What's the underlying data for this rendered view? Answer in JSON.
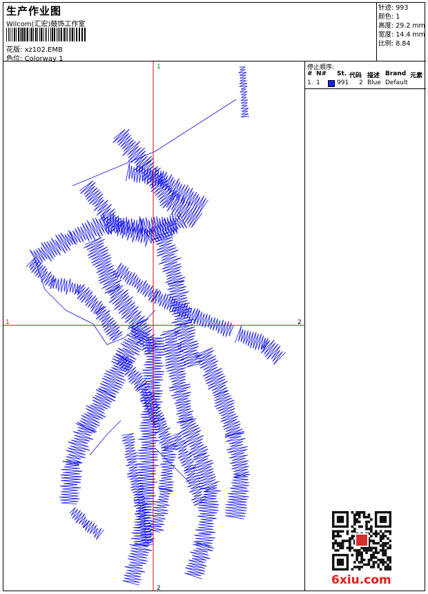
{
  "header": {
    "title": "生产作业图",
    "software": "Wilcom(汇宏)鼓饰工作室",
    "design_label": "花版:",
    "design_value": "xz102.EMB",
    "color_label": "色位:",
    "color_value": "Colorway 1"
  },
  "stats": {
    "stitches_label": "针迹:",
    "stitches_value": "993",
    "colors_label": "颜色:",
    "colors_value": "1",
    "height_label": "高度:",
    "height_value": "29.2 mm",
    "width_label": "宽度:",
    "width_value": "14.4 mm",
    "scale_label": "比例:",
    "scale_value": "8.84"
  },
  "stops": {
    "title": "停止顺序:",
    "columns": [
      "#",
      "N#",
      "St.",
      "代码",
      "描述",
      "Brand",
      "元素"
    ],
    "rows": [
      {
        "index": "1.",
        "needle": "1",
        "stitches": "991",
        "code": "2",
        "description": "Blue",
        "brand": "Default",
        "color": "#1a1aff"
      }
    ]
  },
  "axes": {
    "top_label": "1",
    "bottom_label": "2",
    "left_label": "1",
    "right_label": "2",
    "color": "#e00000"
  },
  "stitch_color": "#1010ee",
  "watermark": "6xiu.com"
}
